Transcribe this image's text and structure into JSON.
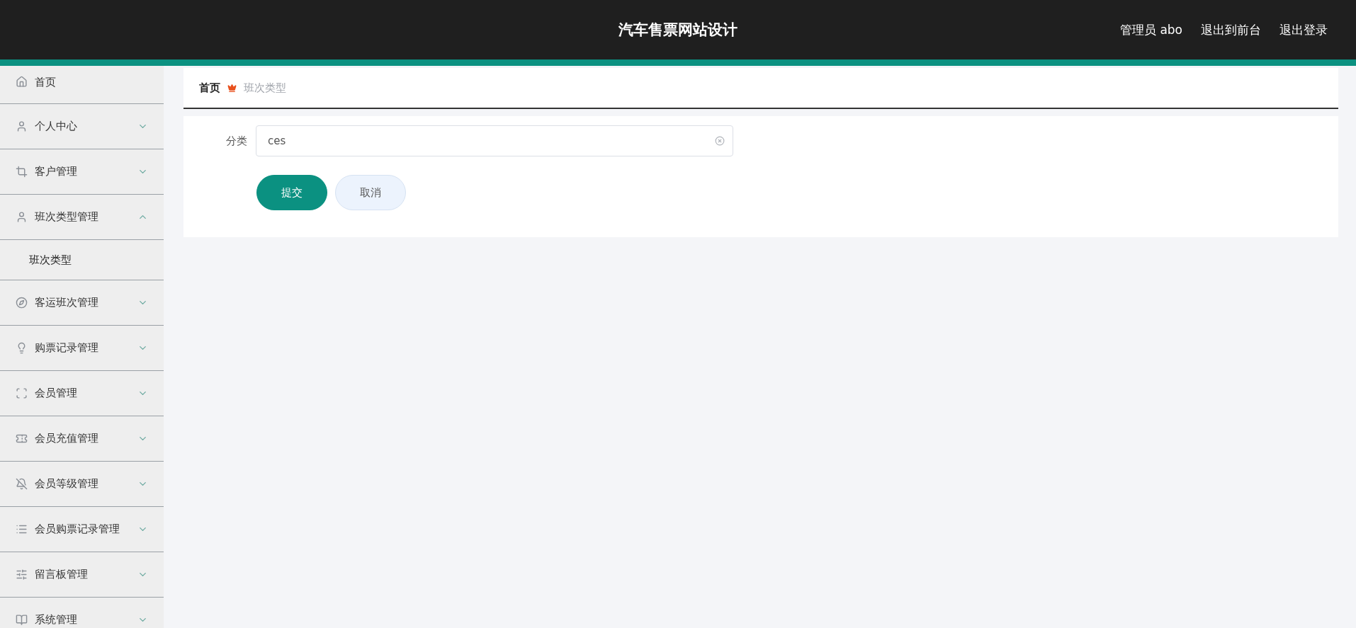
{
  "header": {
    "title": "汽车售票网站设计",
    "links": [
      "管理员 abo",
      "退出到前台",
      "退出登录"
    ]
  },
  "sidebar": {
    "items": [
      {
        "label": "首页",
        "kind": "link"
      },
      {
        "label": "个人中心",
        "kind": "menu",
        "expanded": false
      },
      {
        "label": "客户管理",
        "kind": "menu",
        "expanded": false
      },
      {
        "label": "班次类型管理",
        "kind": "menu",
        "expanded": true,
        "children": [
          {
            "label": "班次类型"
          }
        ]
      },
      {
        "label": "客运班次管理",
        "kind": "menu",
        "expanded": false
      },
      {
        "label": "购票记录管理",
        "kind": "menu",
        "expanded": false
      },
      {
        "label": "会员管理",
        "kind": "menu",
        "expanded": false
      },
      {
        "label": "会员充值管理",
        "kind": "menu",
        "expanded": false
      },
      {
        "label": "会员等级管理",
        "kind": "menu",
        "expanded": false
      },
      {
        "label": "会员购票记录管理",
        "kind": "menu",
        "expanded": false
      },
      {
        "label": "留言板管理",
        "kind": "menu",
        "expanded": false
      },
      {
        "label": "系统管理",
        "kind": "menu",
        "expanded": false
      }
    ]
  },
  "breadcrumb": [
    "首页",
    "班次类型"
  ],
  "form": {
    "fields": [
      {
        "label": "分类",
        "value": "ces"
      }
    ],
    "buttons": [
      {
        "label": "提交",
        "kind": "primary"
      },
      {
        "label": "取消",
        "kind": "secondary"
      }
    ]
  }
}
